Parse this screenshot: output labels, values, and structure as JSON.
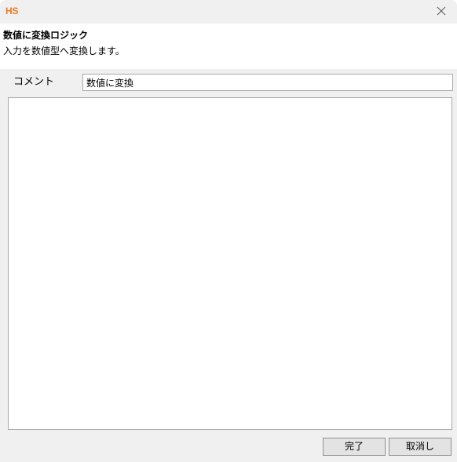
{
  "window": {
    "app_logo": "HS",
    "close_icon": "close-icon"
  },
  "header": {
    "title": "数値に変換ロジック",
    "description": "入力を数値型へ変換します。"
  },
  "form": {
    "comment_label": "コメント",
    "comment_value": "数値に変換"
  },
  "buttons": {
    "ok_label": "完了",
    "cancel_label": "取消し"
  },
  "colors": {
    "logo": "#f07a1e",
    "dialog_background": "#f0f0f0",
    "header_background": "#ffffff",
    "border": "#a9a9a9"
  }
}
